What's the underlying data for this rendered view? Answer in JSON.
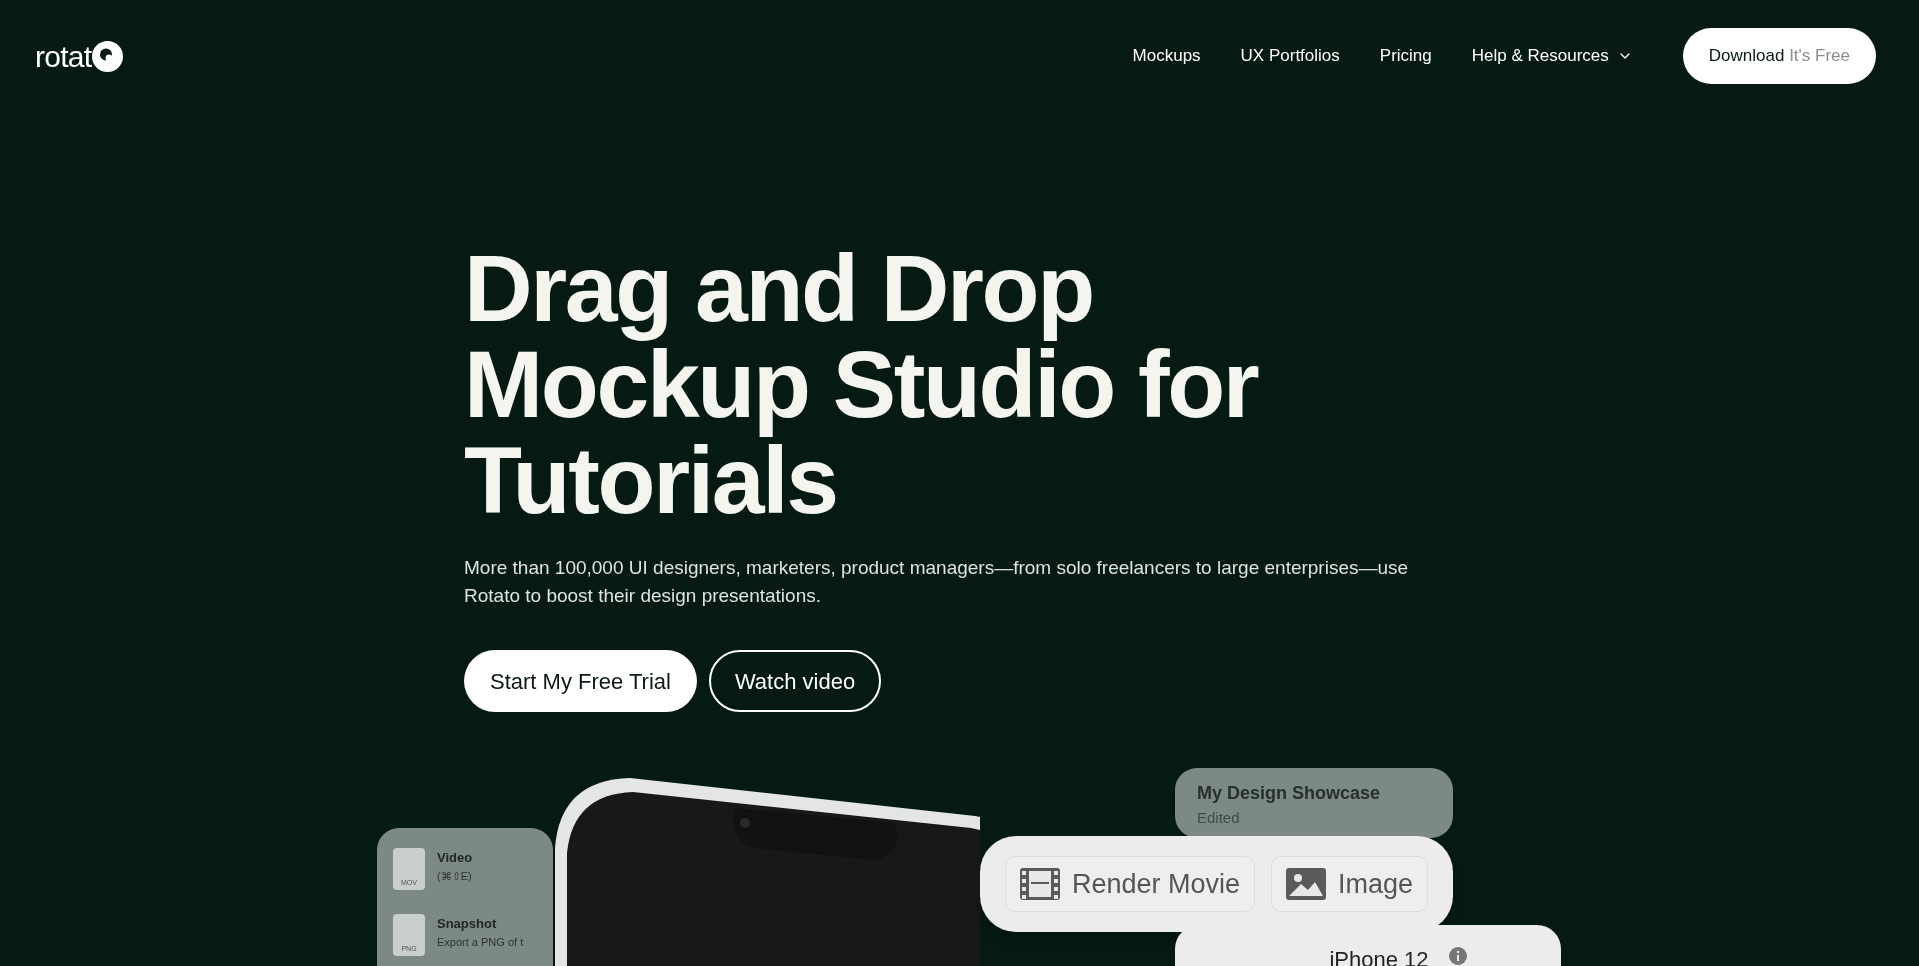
{
  "nav": {
    "logo": "rotat",
    "links": [
      {
        "label": "Mockups",
        "dropdown": false
      },
      {
        "label": "UX Portfolios",
        "dropdown": false
      },
      {
        "label": "Pricing",
        "dropdown": false
      },
      {
        "label": "Help & Resources",
        "dropdown": true
      }
    ],
    "cta": {
      "label": "Download",
      "note": "It's Free"
    }
  },
  "hero": {
    "title_lines": [
      "Drag and Drop",
      "Mockup Studio for",
      "Tutorials"
    ],
    "subtitle": "More than 100,000 UI designers, marketers, product managers—from solo freelancers to large enterprises—use Rotato to boost their design presentations.",
    "buttons": [
      {
        "label": "Start My Free Trial",
        "kind": "primary"
      },
      {
        "label": "Watch video",
        "kind": "outline"
      }
    ]
  },
  "showcase": {
    "export_menu": [
      {
        "title": "Video",
        "detail": "(⌘⇧E)",
        "file": "MOV"
      },
      {
        "title": "Snapshot",
        "detail": "Export a PNG of t",
        "file": "PNG"
      }
    ],
    "project": {
      "name": "My Design Showcase",
      "status": "Edited"
    },
    "render_buttons": [
      {
        "label": "Render Movie",
        "kind": "film"
      },
      {
        "label": "Image",
        "kind": "image"
      }
    ],
    "device": {
      "name": "iPhone 12"
    }
  }
}
